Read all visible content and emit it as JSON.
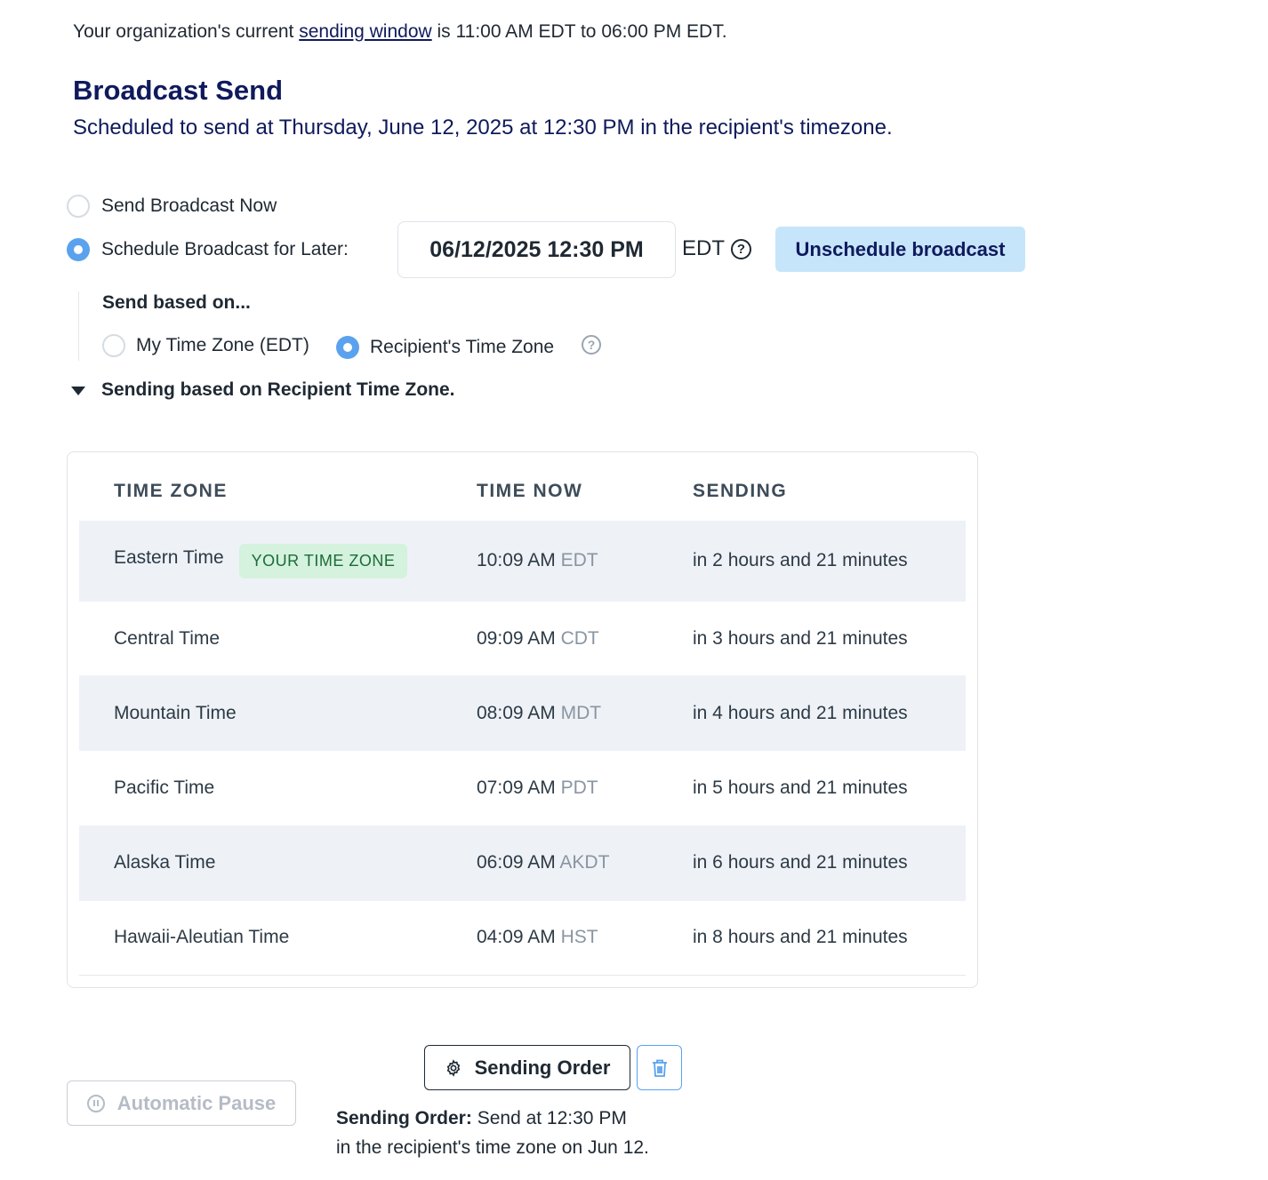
{
  "sending_window": {
    "prefix": "Your organization's current",
    "link": "sending window",
    "suffix": "is 11:00 AM EDT to 06:00 PM EDT."
  },
  "header": {
    "title": "Broadcast Send",
    "subtitle": "Scheduled to send at Thursday, June 12, 2025 at 12:30 PM in the recipient's timezone."
  },
  "schedule": {
    "option_now": "Send Broadcast Now",
    "option_later": "Schedule Broadcast for Later:",
    "selected": "later",
    "datetime_value": "06/12/2025 12:30 PM",
    "timezone": "EDT",
    "help_symbol": "?",
    "unschedule_label": "Unschedule broadcast"
  },
  "send_based": {
    "title": "Send based on...",
    "option_my_tz": "My Time Zone (EDT)",
    "option_recipient_tz": "Recipient's Time Zone",
    "selected": "recipient",
    "disclosure_label": "Sending based on Recipient Time Zone."
  },
  "table": {
    "headers": [
      "TIME ZONE",
      "TIME NOW",
      "SENDING"
    ],
    "your_tz_badge": "YOUR TIME ZONE",
    "rows": [
      {
        "zone": "Eastern Time",
        "time": "10:09 AM",
        "abbr": "EDT",
        "sending": "in 2 hours and 21 minutes"
      },
      {
        "zone": "Central Time",
        "time": "09:09 AM",
        "abbr": "CDT",
        "sending": "in 3 hours and 21 minutes"
      },
      {
        "zone": "Mountain Time",
        "time": "08:09 AM",
        "abbr": "MDT",
        "sending": "in 4 hours and 21 minutes"
      },
      {
        "zone": "Pacific Time",
        "time": "07:09 AM",
        "abbr": "PDT",
        "sending": "in 5 hours and 21 minutes"
      },
      {
        "zone": "Alaska Time",
        "time": "06:09 AM",
        "abbr": "AKDT",
        "sending": "in 6 hours and 21 minutes"
      },
      {
        "zone": "Hawaii-Aleutian Time",
        "time": "04:09 AM",
        "abbr": "HST",
        "sending": "in 8 hours and 21 minutes"
      }
    ]
  },
  "footer": {
    "pause_label": "Automatic Pause",
    "order_label": "Sending Order",
    "summary_bold": "Sending Order:",
    "summary_line1": "Send at 12:30 PM",
    "summary_line2": "in the recipient's time zone on Jun 12."
  },
  "colors": {
    "accent": "#5aa2ee",
    "title": "#0f1a5c",
    "row_shade": "#eef2f7",
    "badge_bg": "#d4f2dd",
    "unschedule_bg": "#c7e5fa"
  }
}
